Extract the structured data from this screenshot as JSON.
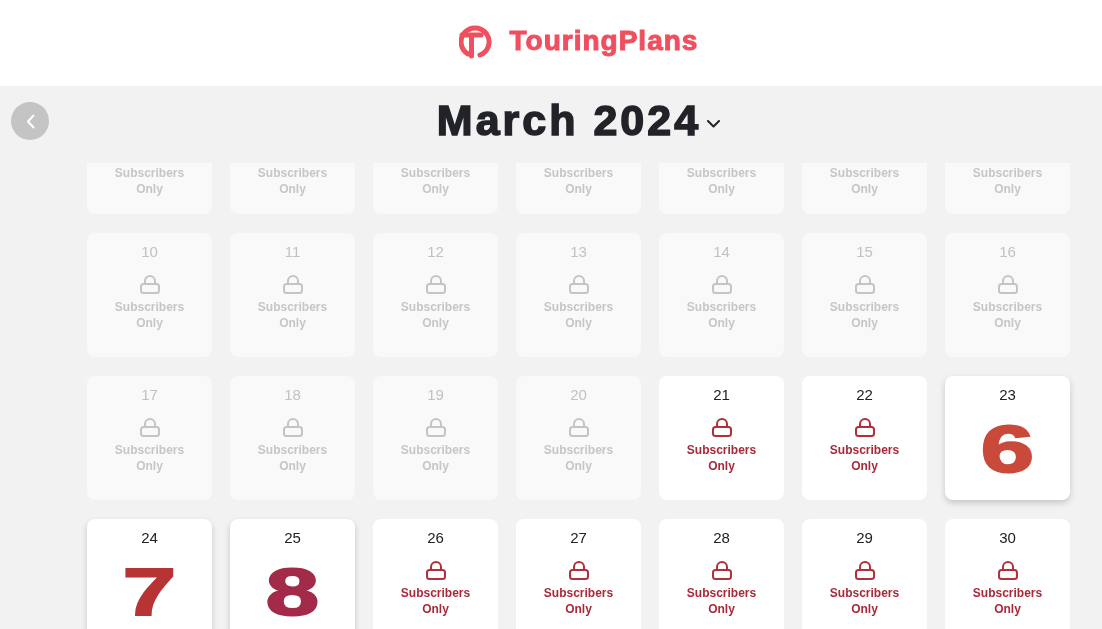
{
  "header": {
    "logo_text": "TouringPlans"
  },
  "month_picker": {
    "title": "March 2024"
  },
  "calendar": {
    "partial_row": [
      {
        "label": "Subscribers Only",
        "disabled": true
      },
      {
        "label": "Subscribers Only",
        "disabled": true
      },
      {
        "label": "Subscribers Only",
        "disabled": true
      },
      {
        "label": "Subscribers Only",
        "disabled": true
      },
      {
        "label": "Subscribers Only",
        "disabled": true
      },
      {
        "label": "Subscribers Only",
        "disabled": true
      },
      {
        "label": "Subscribers Only",
        "disabled": true
      }
    ],
    "days": [
      {
        "day": "10",
        "kind": "locked",
        "label": "Subscribers Only",
        "disabled": true
      },
      {
        "day": "11",
        "kind": "locked",
        "label": "Subscribers Only",
        "disabled": true
      },
      {
        "day": "12",
        "kind": "locked",
        "label": "Subscribers Only",
        "disabled": true
      },
      {
        "day": "13",
        "kind": "locked",
        "label": "Subscribers Only",
        "disabled": true
      },
      {
        "day": "14",
        "kind": "locked",
        "label": "Subscribers Only",
        "disabled": true
      },
      {
        "day": "15",
        "kind": "locked",
        "label": "Subscribers Only",
        "disabled": true
      },
      {
        "day": "16",
        "kind": "locked",
        "label": "Subscribers Only",
        "disabled": true
      },
      {
        "day": "17",
        "kind": "locked",
        "label": "Subscribers Only",
        "disabled": true
      },
      {
        "day": "18",
        "kind": "locked",
        "label": "Subscribers Only",
        "disabled": true
      },
      {
        "day": "19",
        "kind": "locked",
        "label": "Subscribers Only",
        "disabled": true
      },
      {
        "day": "20",
        "kind": "locked",
        "label": "Subscribers Only",
        "disabled": true
      },
      {
        "day": "21",
        "kind": "locked",
        "label": "Subscribers Only",
        "disabled": false
      },
      {
        "day": "22",
        "kind": "locked",
        "label": "Subscribers Only",
        "disabled": false
      },
      {
        "day": "23",
        "kind": "crowd",
        "crowd_level": "6",
        "color": "#c94a3a",
        "disabled": false
      },
      {
        "day": "24",
        "kind": "crowd",
        "crowd_level": "7",
        "color": "#b83434",
        "disabled": false
      },
      {
        "day": "25",
        "kind": "crowd",
        "crowd_level": "8",
        "color": "#a32a48",
        "disabled": false
      },
      {
        "day": "26",
        "kind": "locked",
        "label": "Subscribers Only",
        "disabled": false
      },
      {
        "day": "27",
        "kind": "locked",
        "label": "Subscribers Only",
        "disabled": false
      },
      {
        "day": "28",
        "kind": "locked",
        "label": "Subscribers Only",
        "disabled": false
      },
      {
        "day": "29",
        "kind": "locked",
        "label": "Subscribers Only",
        "disabled": false
      },
      {
        "day": "30",
        "kind": "locked",
        "label": "Subscribers Only",
        "disabled": false
      }
    ]
  }
}
